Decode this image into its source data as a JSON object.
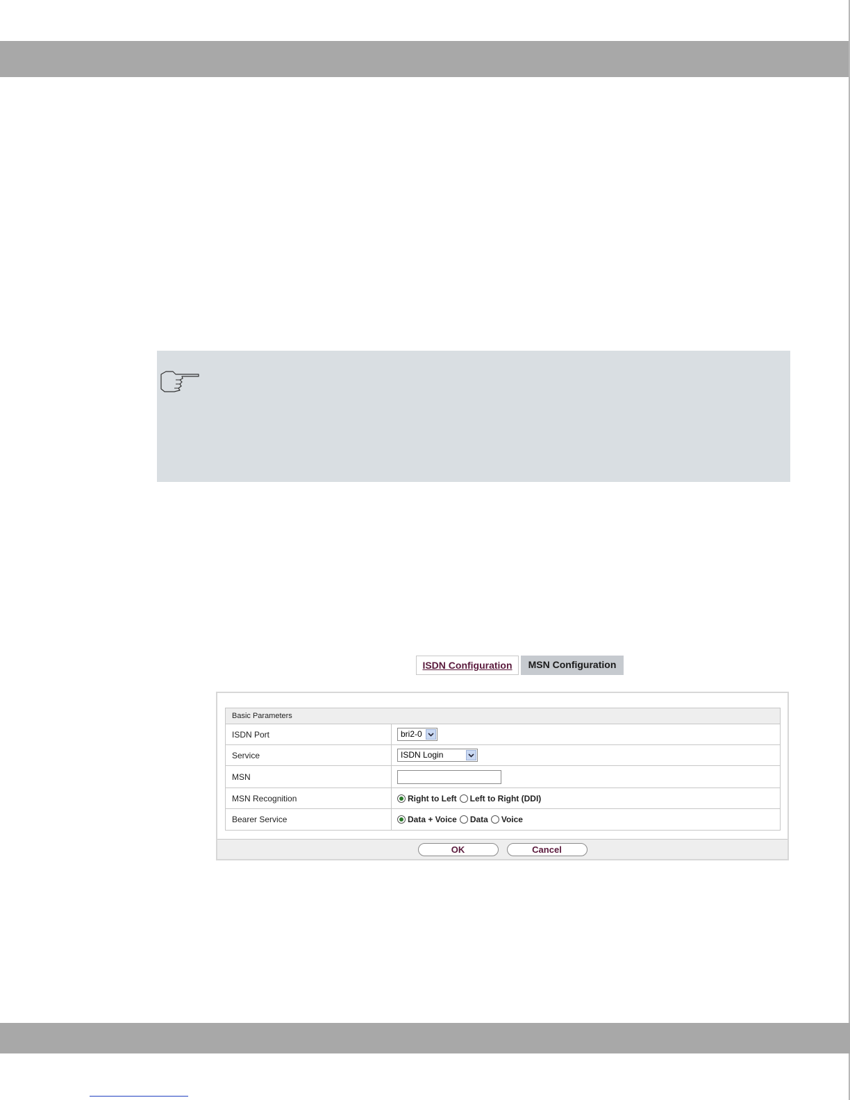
{
  "tabs": [
    {
      "label": "ISDN Configuration",
      "active": false
    },
    {
      "label": "MSN Configuration",
      "active": true
    }
  ],
  "panel": {
    "section_title": "Basic Parameters",
    "rows": {
      "isdn_port": {
        "label": "ISDN Port",
        "value": "bri2-0"
      },
      "service": {
        "label": "Service",
        "value": "ISDN Login"
      },
      "msn": {
        "label": "MSN",
        "value": ""
      },
      "msn_recognition": {
        "label": "MSN Recognition",
        "options": [
          "Right to Left",
          "Left to Right (DDI)"
        ],
        "selected": "Right to Left"
      },
      "bearer_service": {
        "label": "Bearer Service",
        "options": [
          "Data + Voice",
          "Data",
          "Voice"
        ],
        "selected": "Data + Voice"
      }
    }
  },
  "buttons": {
    "ok": "OK",
    "cancel": "Cancel"
  },
  "icons": {
    "note": "pointing-hand-icon",
    "dropdown": "chevron-down-icon"
  },
  "colors": {
    "band": "#a8a8a8",
    "note_bg": "#d9dee2",
    "link": "#5a1a3c",
    "active_tab": "#c6cacf"
  }
}
